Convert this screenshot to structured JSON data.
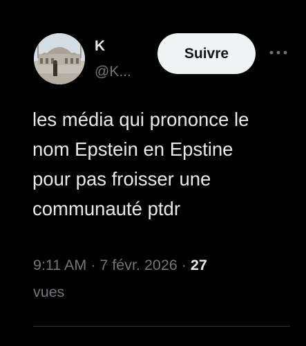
{
  "author": {
    "display_name": "K",
    "handle": "@K...",
    "avatar_icon": "mosque-courtyard-photo"
  },
  "actions": {
    "follow_label": "Suivre",
    "more_icon": "more-horizontal-icon"
  },
  "tweet": {
    "text": "les média qui prononce le\nnom Epstein en Epstine\npour pas froisser une\ncommunauté ptdr"
  },
  "meta": {
    "time": "9:11 AM",
    "separator": " · ",
    "date": "7 févr. 2026",
    "views_count": "27",
    "views_label": "vues"
  },
  "colors": {
    "background": "#000000",
    "text_primary": "#e7e9ea",
    "text_secondary": "#71767b",
    "follow_bg": "#eff3f4",
    "divider": "#2f3336"
  }
}
